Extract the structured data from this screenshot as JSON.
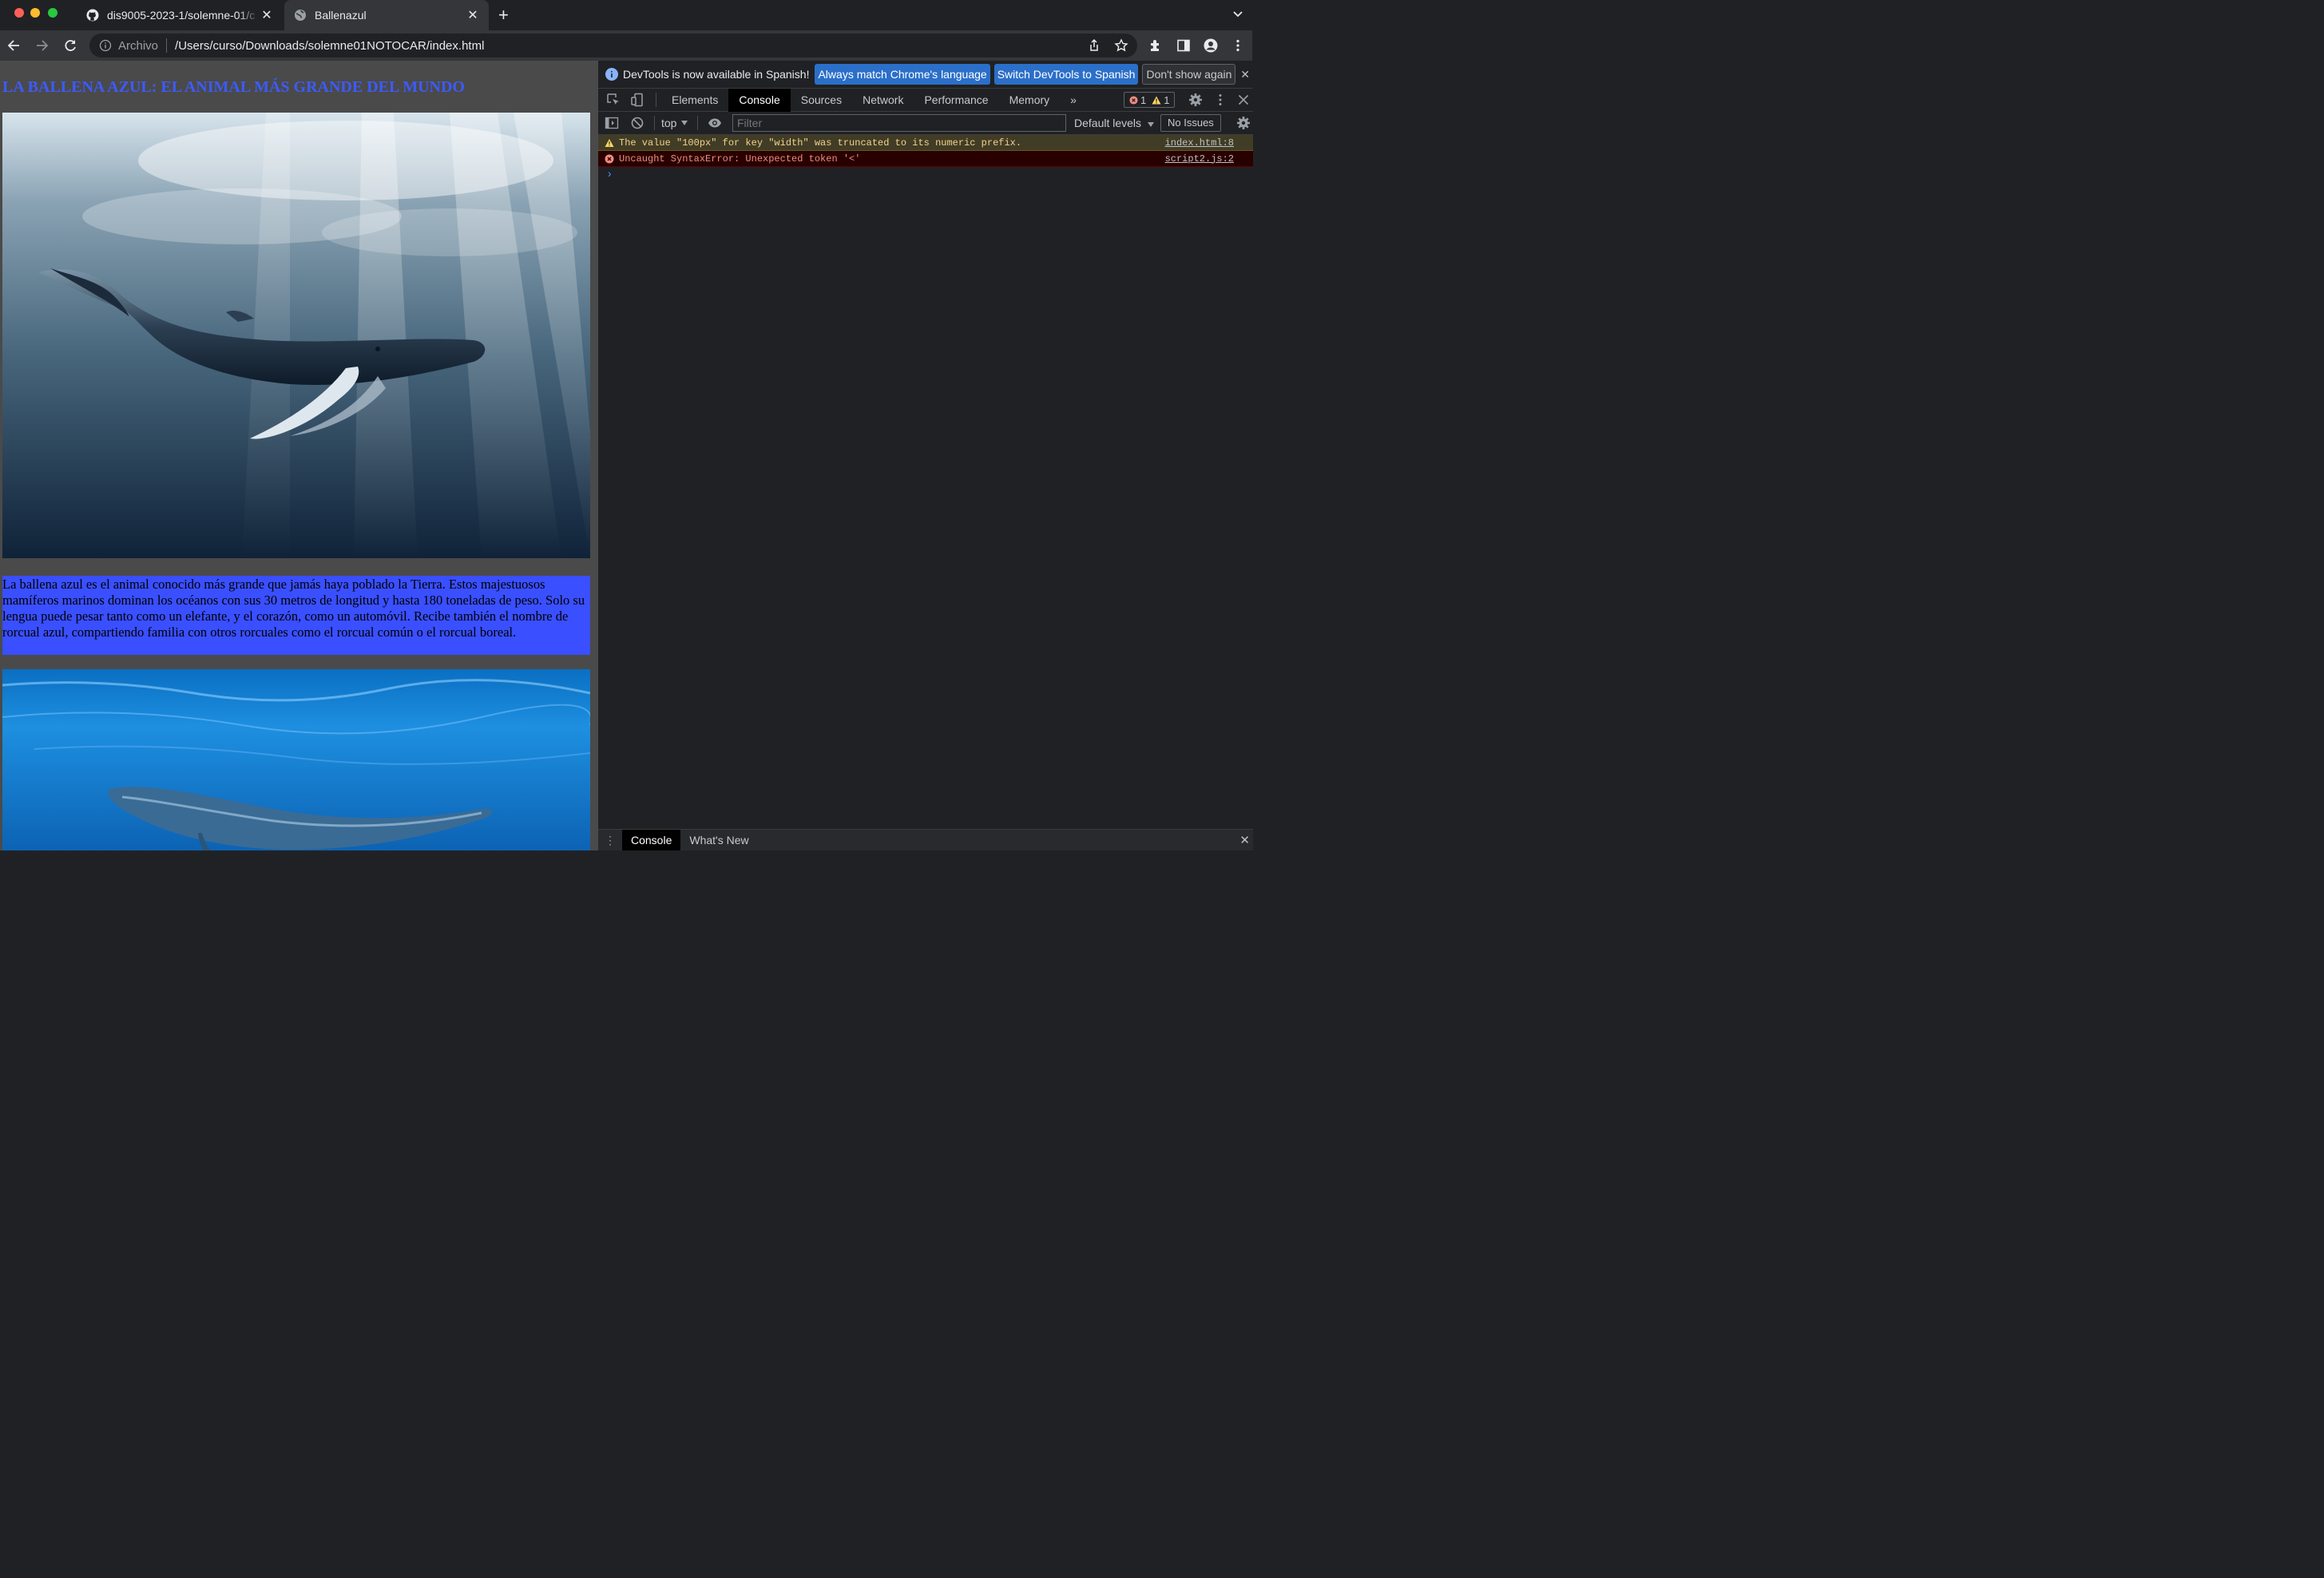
{
  "browser": {
    "tabs": [
      {
        "title": "dis9005-2023-1/solemne-01/c",
        "icon": "github-icon",
        "active": false
      },
      {
        "title": "Ballenazul",
        "icon": "globe-icon",
        "active": true
      }
    ],
    "new_tab": "+",
    "close_glyph": "✕",
    "omnibox": {
      "scheme_label": "Archivo",
      "url": "/Users/curso/Downloads/solemne01NOTOCAR/index.html"
    }
  },
  "page": {
    "heading": "LA BALLENA AZUL: EL ANIMAL MÁS GRANDE DEL MUNDO",
    "paragraph": "La ballena azul es el animal conocido más grande que jamás haya poblado la Tierra. Estos majestuosos mamíferos marinos dominan los océanos con sus 30 metros de longitud y hasta 180 toneladas de peso. Solo su lengua puede pesar tanto como un elefante, y el corazón, como un automóvil. Recibe también el nombre de rorcual azul, compartiendo familia con otros rorcuales como el rorcual común o el rorcual boreal.",
    "colors": {
      "heading": "#3c5bff",
      "paragraph_bg": "#3a4fff",
      "page_bg": "#4a4a4a"
    }
  },
  "devtools": {
    "infobar": {
      "message": "DevTools is now available in Spanish!",
      "btn_match": "Always match Chrome's language",
      "btn_switch": "Switch DevTools to Spanish",
      "btn_dismiss": "Don't show again"
    },
    "tabs": [
      "Elements",
      "Console",
      "Sources",
      "Network",
      "Performance",
      "Memory"
    ],
    "active_tab": "Console",
    "more": "»",
    "error_count": "1",
    "warning_count": "1",
    "console_toolbar": {
      "context": "top",
      "filter_placeholder": "Filter",
      "levels": "Default levels",
      "issues": "No Issues"
    },
    "messages": [
      {
        "level": "warning",
        "text": "The value \"100px\" for key \"width\" was truncated to its numeric prefix.",
        "source": "index.html:8"
      },
      {
        "level": "error",
        "text": "Uncaught SyntaxError: Unexpected token '<'",
        "source": "script2.js:2"
      }
    ],
    "prompt": "›",
    "drawer_tabs": [
      "Console",
      "What's New"
    ]
  }
}
